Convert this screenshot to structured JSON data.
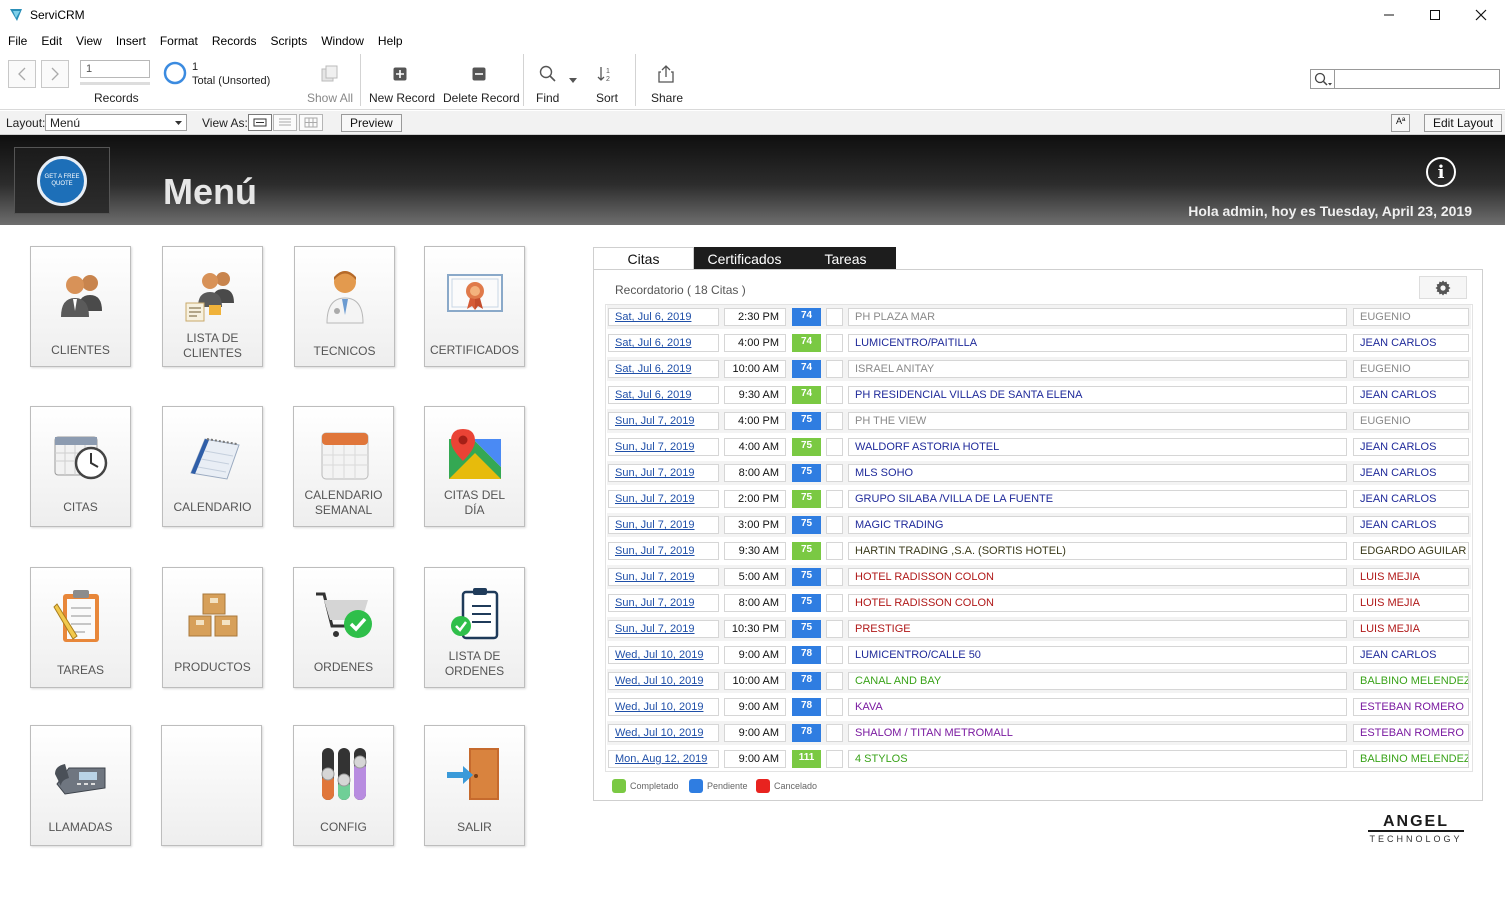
{
  "window": {
    "title": "ServiCRM"
  },
  "menu": [
    "File",
    "Edit",
    "View",
    "Insert",
    "Format",
    "Records",
    "Scripts",
    "Window",
    "Help"
  ],
  "toolbar": {
    "record_value": "1",
    "records_label": "Records",
    "found_count": "1",
    "total_label": "Total (Unsorted)",
    "show_all": "Show All",
    "new_record": "New Record",
    "delete_record": "Delete Record",
    "find": "Find",
    "sort": "Sort",
    "share": "Share"
  },
  "layoutbar": {
    "layout_label": "Layout:",
    "layout_value": "Menú",
    "view_as_label": "View As:",
    "preview": "Preview",
    "aa": "Aª",
    "edit_layout": "Edit Layout"
  },
  "header": {
    "logo_text": "GET A FREE QUOTE",
    "title": "Menú",
    "greeting": "Hola admin, hoy es Tuesday, April 23, 2019"
  },
  "tiles": [
    {
      "label": "CLIENTES",
      "icon": "users-icon"
    },
    {
      "label": "LISTA DE\nCLIENTES",
      "icon": "client-list-icon"
    },
    {
      "label": "TECNICOS",
      "icon": "technician-icon"
    },
    {
      "label": "CERTIFICADOS",
      "icon": "certificate-icon"
    },
    {
      "label": "CITAS",
      "icon": "appointments-clock-icon"
    },
    {
      "label": "CALENDARIO",
      "icon": "calendar-icon"
    },
    {
      "label": "CALENDARIO\nSEMANAL",
      "icon": "weekly-calendar-icon"
    },
    {
      "label": "CITAS DEL\nDÍA",
      "icon": "map-pin-icon"
    },
    {
      "label": "TAREAS",
      "icon": "task-clipboard-icon"
    },
    {
      "label": "PRODUCTOS",
      "icon": "boxes-icon"
    },
    {
      "label": "ORDENES",
      "icon": "cart-check-icon"
    },
    {
      "label": "LISTA DE\nORDENES",
      "icon": "order-list-icon"
    },
    {
      "label": "LLAMADAS",
      "icon": "phone-icon"
    },
    {
      "label": "",
      "icon": ""
    },
    {
      "label": "CONFIG",
      "icon": "sliders-icon"
    },
    {
      "label": "SALIR",
      "icon": "exit-door-icon"
    }
  ],
  "tabs": [
    "Citas",
    "Certificados",
    "Tareas"
  ],
  "reminder": "Recordatorio  ( 18  Citas )",
  "colors": {
    "completed": "#7ac943",
    "pending": "#2f7de1",
    "cancelled": "#e8231f"
  },
  "appointments": [
    {
      "date": "Sat, Jul 6, 2019",
      "time": "2:30 PM",
      "num": "74",
      "status": "pending",
      "place": "PH PLAZA MAR",
      "tech": "EUGENIO",
      "color": "#8a8a8a"
    },
    {
      "date": "Sat, Jul 6, 2019",
      "time": "4:00 PM",
      "num": "74",
      "status": "completed",
      "place": "LUMICENTRO/PAITILLA",
      "tech": "JEAN CARLOS",
      "color": "#1f2a9a"
    },
    {
      "date": "Sat, Jul 6, 2019",
      "time": "10:00 AM",
      "num": "74",
      "status": "pending",
      "place": "ISRAEL ANITAY",
      "tech": "EUGENIO",
      "color": "#8a8a8a"
    },
    {
      "date": "Sat, Jul 6, 2019",
      "time": "9:30 AM",
      "num": "74",
      "status": "completed",
      "place": "PH RESIDENCIAL VILLAS DE SANTA ELENA",
      "tech": "JEAN CARLOS",
      "color": "#1f2a9a"
    },
    {
      "date": "Sun, Jul 7, 2019",
      "time": "4:00 PM",
      "num": "75",
      "status": "pending",
      "place": "PH THE VIEW",
      "tech": "EUGENIO",
      "color": "#8a8a8a"
    },
    {
      "date": "Sun, Jul 7, 2019",
      "time": "4:00 AM",
      "num": "75",
      "status": "completed",
      "place": "WALDORF ASTORIA HOTEL",
      "tech": "JEAN CARLOS",
      "color": "#1f2a9a"
    },
    {
      "date": "Sun, Jul 7, 2019",
      "time": "8:00 AM",
      "num": "75",
      "status": "pending",
      "place": "MLS SOHO",
      "tech": "JEAN CARLOS",
      "color": "#1f2a9a"
    },
    {
      "date": "Sun, Jul 7, 2019",
      "time": "2:00 PM",
      "num": "75",
      "status": "completed",
      "place": "GRUPO SILABA /VILLA DE LA FUENTE",
      "tech": "JEAN CARLOS",
      "color": "#1f2a9a"
    },
    {
      "date": "Sun, Jul 7, 2019",
      "time": "3:00 PM",
      "num": "75",
      "status": "pending",
      "place": "MAGIC TRADING",
      "tech": "JEAN CARLOS",
      "color": "#1f2a9a"
    },
    {
      "date": "Sun, Jul 7, 2019",
      "time": "9:30 AM",
      "num": "75",
      "status": "completed",
      "place": "HARTIN TRADING ,S.A. (SORTIS HOTEL)",
      "tech": "EDGARDO AGUILAR",
      "color": "#3a3a1a"
    },
    {
      "date": "Sun, Jul 7, 2019",
      "time": "5:00 AM",
      "num": "75",
      "status": "pending",
      "place": "HOTEL RADISSON COLON",
      "tech": "LUIS MEJIA",
      "color": "#b01818"
    },
    {
      "date": "Sun, Jul 7, 2019",
      "time": "8:00 AM",
      "num": "75",
      "status": "pending",
      "place": "HOTEL RADISSON COLON",
      "tech": "LUIS MEJIA",
      "color": "#b01818"
    },
    {
      "date": "Sun, Jul 7, 2019",
      "time": "10:30 PM",
      "num": "75",
      "status": "pending",
      "place": "PRESTIGE",
      "tech": "LUIS MEJIA",
      "color": "#b01818"
    },
    {
      "date": "Wed, Jul 10, 2019",
      "time": "9:00 AM",
      "num": "78",
      "status": "pending",
      "place": "LUMICENTRO/CALLE 50",
      "tech": "JEAN CARLOS",
      "color": "#1f2a9a"
    },
    {
      "date": "Wed, Jul 10, 2019",
      "time": "10:00 AM",
      "num": "78",
      "status": "pending",
      "place": "CANAL AND BAY",
      "tech": "BALBINO MELENDEZ",
      "color": "#3aa31a"
    },
    {
      "date": "Wed, Jul 10, 2019",
      "time": "9:00 AM",
      "num": "78",
      "status": "pending",
      "place": "KAVA",
      "tech": "ESTEBAN ROMERO",
      "color": "#7a1aa0"
    },
    {
      "date": "Wed, Jul 10, 2019",
      "time": "9:00 AM",
      "num": "78",
      "status": "pending",
      "place": "SHALOM / TITAN METROMALL",
      "tech": "ESTEBAN ROMERO",
      "color": "#7a1aa0"
    },
    {
      "date": "Mon, Aug 12, 2019",
      "time": "9:00 AM",
      "num": "111",
      "status": "completed",
      "place": "4 STYLOS",
      "tech": "BALBINO MELENDEZ",
      "color": "#3aa31a"
    }
  ],
  "legend": [
    {
      "label": "Completado",
      "status": "completed"
    },
    {
      "label": "Pendiente",
      "status": "pending"
    },
    {
      "label": "Cancelado",
      "status": "cancelled"
    }
  ],
  "brand": {
    "line1": "ANGEL",
    "line2": "TECHNOLOGY"
  }
}
